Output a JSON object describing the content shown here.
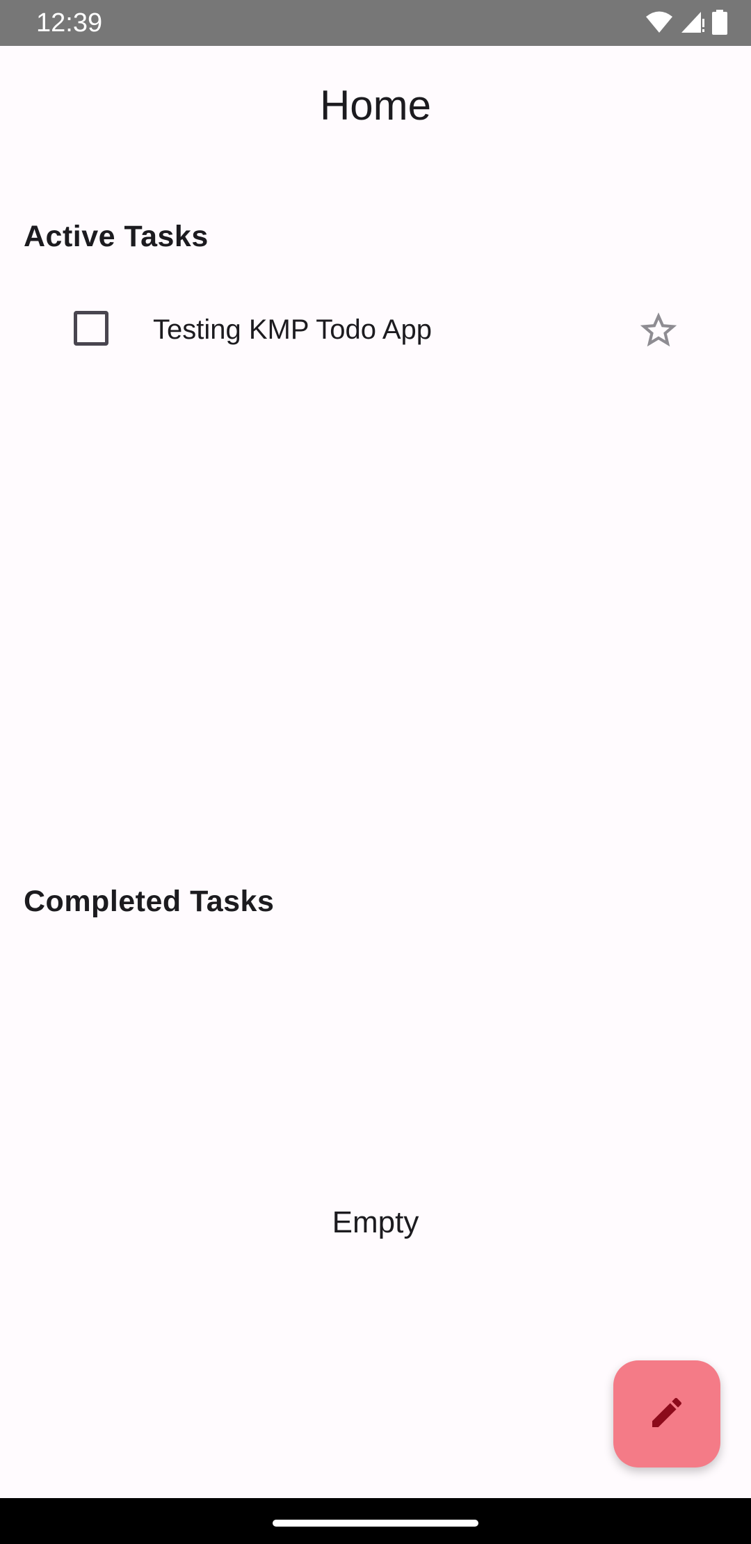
{
  "status_bar": {
    "time": "12:39",
    "icons": [
      "wifi-icon",
      "cell-signal-icon",
      "battery-icon"
    ]
  },
  "app_bar": {
    "title": "Home"
  },
  "active_section": {
    "header": "Active Tasks",
    "tasks": [
      {
        "title": "Testing KMP Todo App",
        "checked": false,
        "starred": false
      }
    ]
  },
  "completed_section": {
    "header": "Completed Tasks",
    "empty_label": "Empty"
  },
  "fab": {
    "icon": "edit-pencil-icon",
    "color": "#f47b87",
    "icon_color": "#8c0b1b"
  },
  "theme": {
    "background": "#fffbfe",
    "status_bar": "#777777",
    "text": "#1c1b1f"
  }
}
